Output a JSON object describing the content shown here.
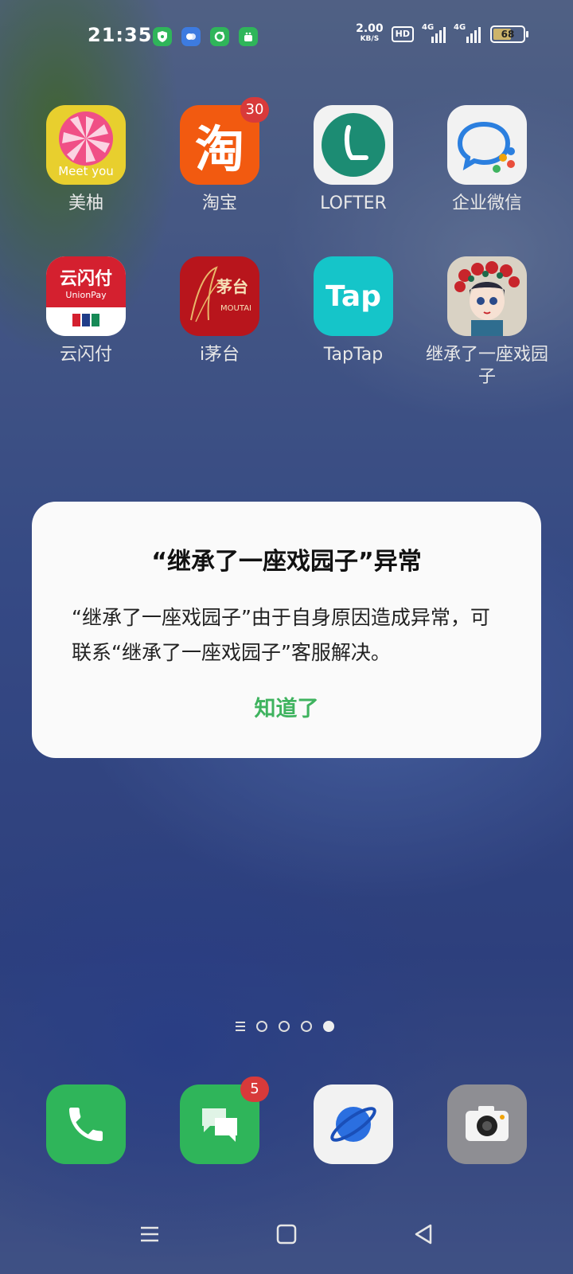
{
  "status_bar": {
    "time": "21:35",
    "speed_value": "2.00",
    "speed_unit": "KB/S",
    "hd": "HD",
    "net1": "4G",
    "net2": "4G",
    "battery": "68",
    "battery_level": 0.68,
    "notification_icons": [
      "shield-icon",
      "bubbles-icon",
      "ring-icon",
      "android-icon"
    ]
  },
  "apps_row1": [
    {
      "label": "美柚",
      "badge": ""
    },
    {
      "label": "淘宝",
      "badge": "30"
    },
    {
      "label": "LOFTER",
      "badge": ""
    },
    {
      "label": "企业微信",
      "badge": ""
    }
  ],
  "apps_row2": [
    {
      "label": "云闪付",
      "badge": ""
    },
    {
      "label": "i茅台",
      "badge": ""
    },
    {
      "label": "TapTap",
      "badge": ""
    },
    {
      "label": "继承了一座戏园子",
      "badge": ""
    }
  ],
  "icon_text": {
    "meetyou": "Meet you",
    "taobao": "淘",
    "unionpay_top": "云闪付",
    "unionpay_sub": "UnionPay",
    "moutai_cn": "茅台",
    "moutai_en": "MOUTAI",
    "taptap": "Tap"
  },
  "dialog": {
    "title": "“继承了一座戏园子”异常",
    "message": "“继承了一座戏园子”由于自身原因造成异常，可联系“继承了一座戏园子”客服解决。",
    "ok_label": "知道了"
  },
  "page_indicator": {
    "pages": 4,
    "current": 4
  },
  "dock": [
    {
      "name": "phone-icon",
      "badge": ""
    },
    {
      "name": "messages-icon",
      "badge": "5"
    },
    {
      "name": "browser-icon",
      "badge": ""
    },
    {
      "name": "camera-icon",
      "badge": ""
    }
  ],
  "colors": {
    "dialog_button": "#3fb35f",
    "badge": "#d83a3a"
  }
}
